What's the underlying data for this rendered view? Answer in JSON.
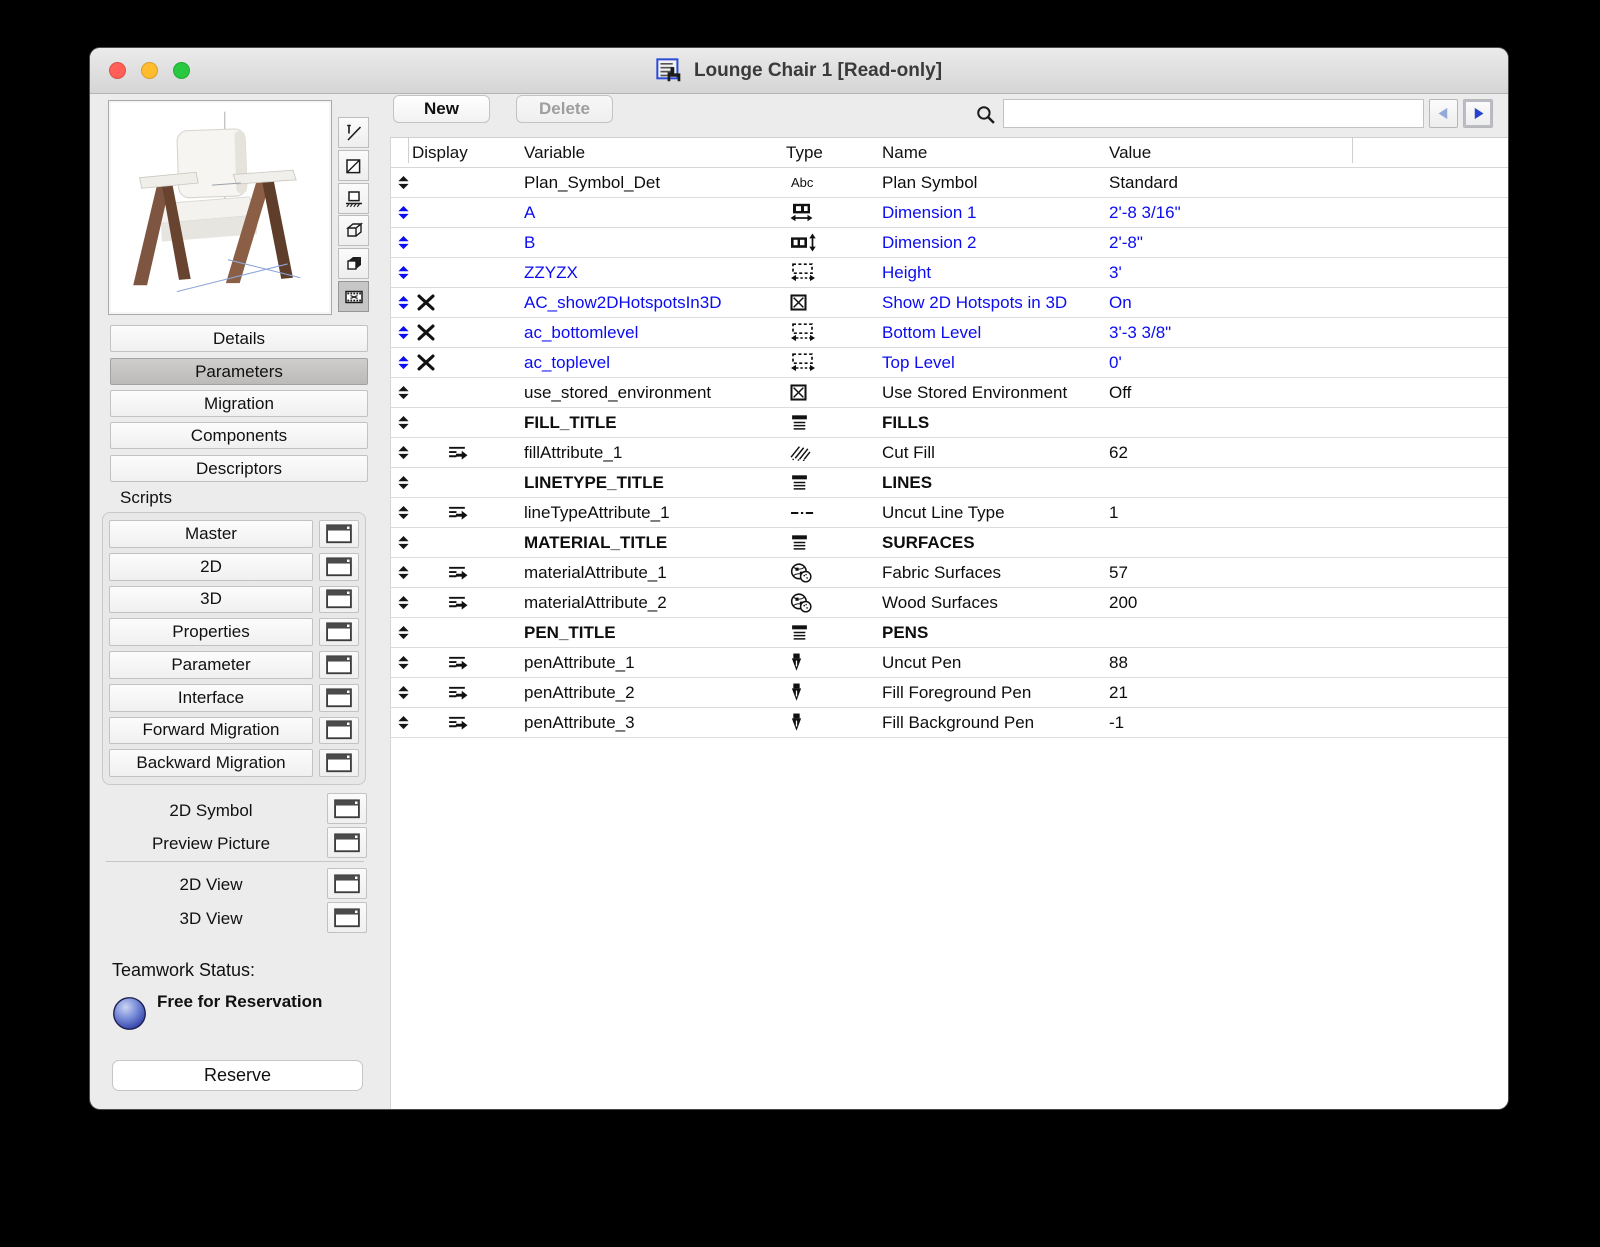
{
  "window": {
    "title": "Lounge Chair 1 [Read-only]"
  },
  "toolbar": {
    "new_label": "New",
    "delete_label": "Delete",
    "search_value": ""
  },
  "sidebar": {
    "tabs": [
      {
        "label": "Details"
      },
      {
        "label": "Parameters"
      },
      {
        "label": "Migration"
      },
      {
        "label": "Components"
      },
      {
        "label": "Descriptors"
      }
    ],
    "scripts_label": "Scripts",
    "scripts": [
      "Master",
      "2D",
      "3D",
      "Properties",
      "Parameter",
      "Interface",
      "Forward Migration",
      "Backward Migration"
    ],
    "views": [
      "2D Symbol",
      "Preview Picture",
      "2D View",
      "3D View"
    ],
    "teamwork": {
      "label": "Teamwork Status:",
      "status": "Free for Reservation",
      "reserve_label": "Reserve"
    }
  },
  "table": {
    "headers": {
      "display": "Display",
      "variable": "Variable",
      "type": "Type",
      "name": "Name",
      "value": "Value"
    },
    "rows": [
      {
        "variable": "Plan_Symbol_Det",
        "type_icon": "abc",
        "name": "Plan Symbol",
        "value": "Standard"
      },
      {
        "variable": "A",
        "type_icon": "dimension-horizontal",
        "name": "Dimension 1",
        "value": "2'-8 3/16\""
      },
      {
        "variable": "B",
        "type_icon": "dimension-vertical",
        "name": "Dimension 2",
        "value": "2'-8\""
      },
      {
        "variable": "ZZYZX",
        "type_icon": "length",
        "name": "Height",
        "value": "3'"
      },
      {
        "variable": "AC_show2DHotspotsIn3D",
        "type_icon": "checkbox",
        "name": "Show 2D Hotspots in 3D",
        "value": "On"
      },
      {
        "variable": "ac_bottomlevel",
        "type_icon": "length",
        "name": "Bottom Level",
        "value": "3'-3 3/8\""
      },
      {
        "variable": "ac_toplevel",
        "type_icon": "length",
        "name": "Top Level",
        "value": "0'"
      },
      {
        "variable": "use_stored_environment",
        "type_icon": "checkbox",
        "name": "Use Stored Environment",
        "value": "Off"
      },
      {
        "variable": "FILL_TITLE",
        "type_icon": "title",
        "name": "FILLS",
        "value": ""
      },
      {
        "variable": "fillAttribute_1",
        "type_icon": "fill",
        "name": "Cut Fill",
        "value": "62"
      },
      {
        "variable": "LINETYPE_TITLE",
        "type_icon": "title",
        "name": "LINES",
        "value": ""
      },
      {
        "variable": "lineTypeAttribute_1",
        "type_icon": "linetype",
        "name": "Uncut Line Type",
        "value": "1"
      },
      {
        "variable": "MATERIAL_TITLE",
        "type_icon": "title",
        "name": "SURFACES",
        "value": ""
      },
      {
        "variable": "materialAttribute_1",
        "type_icon": "material",
        "name": "Fabric Surfaces",
        "value": "57"
      },
      {
        "variable": "materialAttribute_2",
        "type_icon": "material",
        "name": "Wood Surfaces",
        "value": "200"
      },
      {
        "variable": "PEN_TITLE",
        "type_icon": "title",
        "name": "PENS",
        "value": ""
      },
      {
        "variable": "penAttribute_1",
        "type_icon": "pen",
        "name": "Uncut Pen",
        "value": "88"
      },
      {
        "variable": "penAttribute_2",
        "type_icon": "pen",
        "name": "Fill Foreground Pen",
        "value": "21"
      },
      {
        "variable": "penAttribute_3",
        "type_icon": "pen",
        "name": "Fill Background Pen",
        "value": "-1"
      }
    ]
  },
  "colors": {
    "parameter_blue": "#0b0cf0",
    "traffic_red": "#ff5f57",
    "traffic_yellow": "#febc2e",
    "traffic_green": "#28c840",
    "sphere_blue": "#5a74d8"
  },
  "icons": {
    "search": "magnifier",
    "nav_back": "left-triangle",
    "nav_forward": "right-triangle",
    "display_reorder": "up-down-triangles",
    "hidden_parameter": "bold-x",
    "child_attribute": "lines-right-arrow",
    "script_window": "window-with-titlebar"
  }
}
